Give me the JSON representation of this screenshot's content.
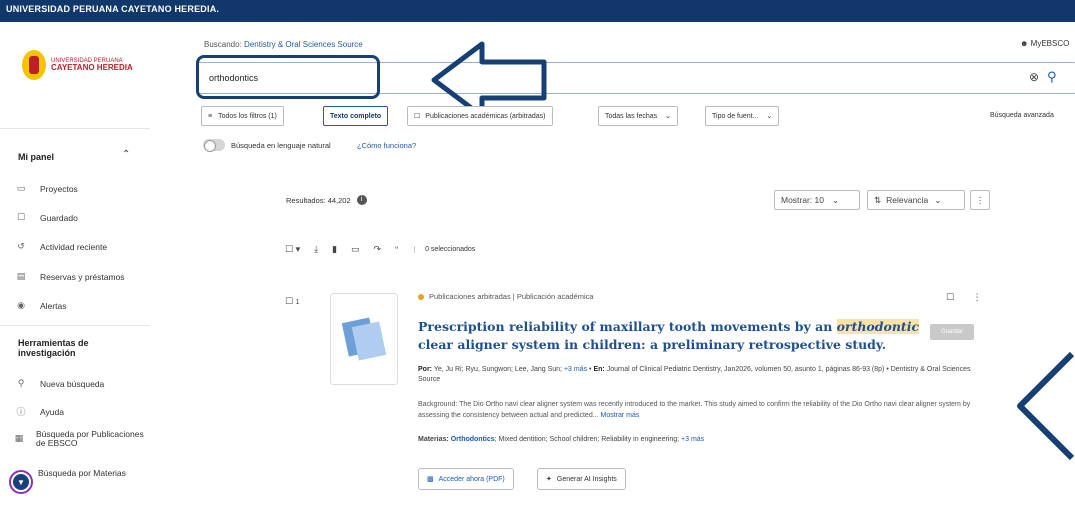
{
  "topbar": {
    "institution": "UNIVERSIDAD PERUANA CAYETANO HEREDIA."
  },
  "sidebar": {
    "logo": {
      "line1": "UNIVERSIDAD PERUANA",
      "line2": "CAYETANO HEREDIA"
    },
    "panel_title": "Mi panel",
    "panel_items": [
      {
        "label": "Proyectos",
        "icon": "folder-icon"
      },
      {
        "label": "Guardado",
        "icon": "bookmark-icon"
      },
      {
        "label": "Actividad reciente",
        "icon": "history-icon"
      },
      {
        "label": "Reservas y préstamos",
        "icon": "library-icon"
      },
      {
        "label": "Alertas",
        "icon": "bell-icon"
      }
    ],
    "tools_title": "Herramientas de investigación",
    "tool_items": [
      {
        "label": "Nueva búsqueda",
        "icon": "search-icon"
      },
      {
        "label": "Ayuda",
        "icon": "help-icon"
      },
      {
        "label": "Búsqueda por Publicaciones de EBSCO",
        "icon": "publications-icon"
      },
      {
        "label": "Búsqueda por Materias",
        "icon": "subjects-icon"
      }
    ]
  },
  "header": {
    "searching_label": "Buscando:",
    "database": "Dentistry & Oral Sciences Source",
    "account": "MyEBSCO"
  },
  "search": {
    "value": "orthodontics"
  },
  "filters": {
    "all_filters": "Todos los filtros (1)",
    "full_text": "Texto completo",
    "peer_reviewed": "Publicaciones académicas (arbitradas)",
    "all_dates": "Todas las fechas",
    "source_type": "Tipo de fuent...",
    "advanced": "Búsqueda avanzada"
  },
  "natural_language": {
    "label": "Búsqueda en lenguaje natural",
    "link": "¿Cómo funciona?"
  },
  "results": {
    "count_label": "Resultados: 44,202",
    "show_label": "Mostrar: 10",
    "sort_label": "Relevancia",
    "selected_label": "0 seleccionados"
  },
  "result": {
    "number": "1",
    "pub_type": "Publicaciones arbitradas | Publicación académica",
    "title_before": "Prescription reliability of maxillary tooth movements by an ",
    "title_highlight": "orthodontic",
    "title_after": " clear aligner system in children: a preliminary retrospective study.",
    "tooltip": "Guardar",
    "authors_label": "Por:",
    "authors": "Ye, Ju Ri; Ryu, Sungwon; Lee, Jang Sun;",
    "authors_more": "+3 más",
    "source_label": "En:",
    "source": "Journal of Clinical Pediatric Dentistry, Jan2026, volumen 50, asunto 1, páginas 86-93 (8p) • Dentistry & Oral Sciences Source",
    "abstract": "Background: The Dio Ortho navi clear aligner system was recently introduced to the market. This study aimed to confirm the reliability of the Dio Ortho navi clear aligner system by assessing the consistency between actual and predicted...",
    "show_more": "Mostrar más",
    "subjects_label": "Materias:",
    "subject_main": "Orthodontics",
    "subjects_rest": "; Mixed dentition; School children; Reliability in engineering;",
    "subjects_more": "+3 más",
    "pdf_button": "Acceder ahora (PDF)",
    "ai_button": "Generar AI Insights"
  },
  "colors": {
    "topbar": "#12376b",
    "link": "#1e5aa8",
    "highlight": "#fbe3a6",
    "annotation": "#153f75"
  }
}
